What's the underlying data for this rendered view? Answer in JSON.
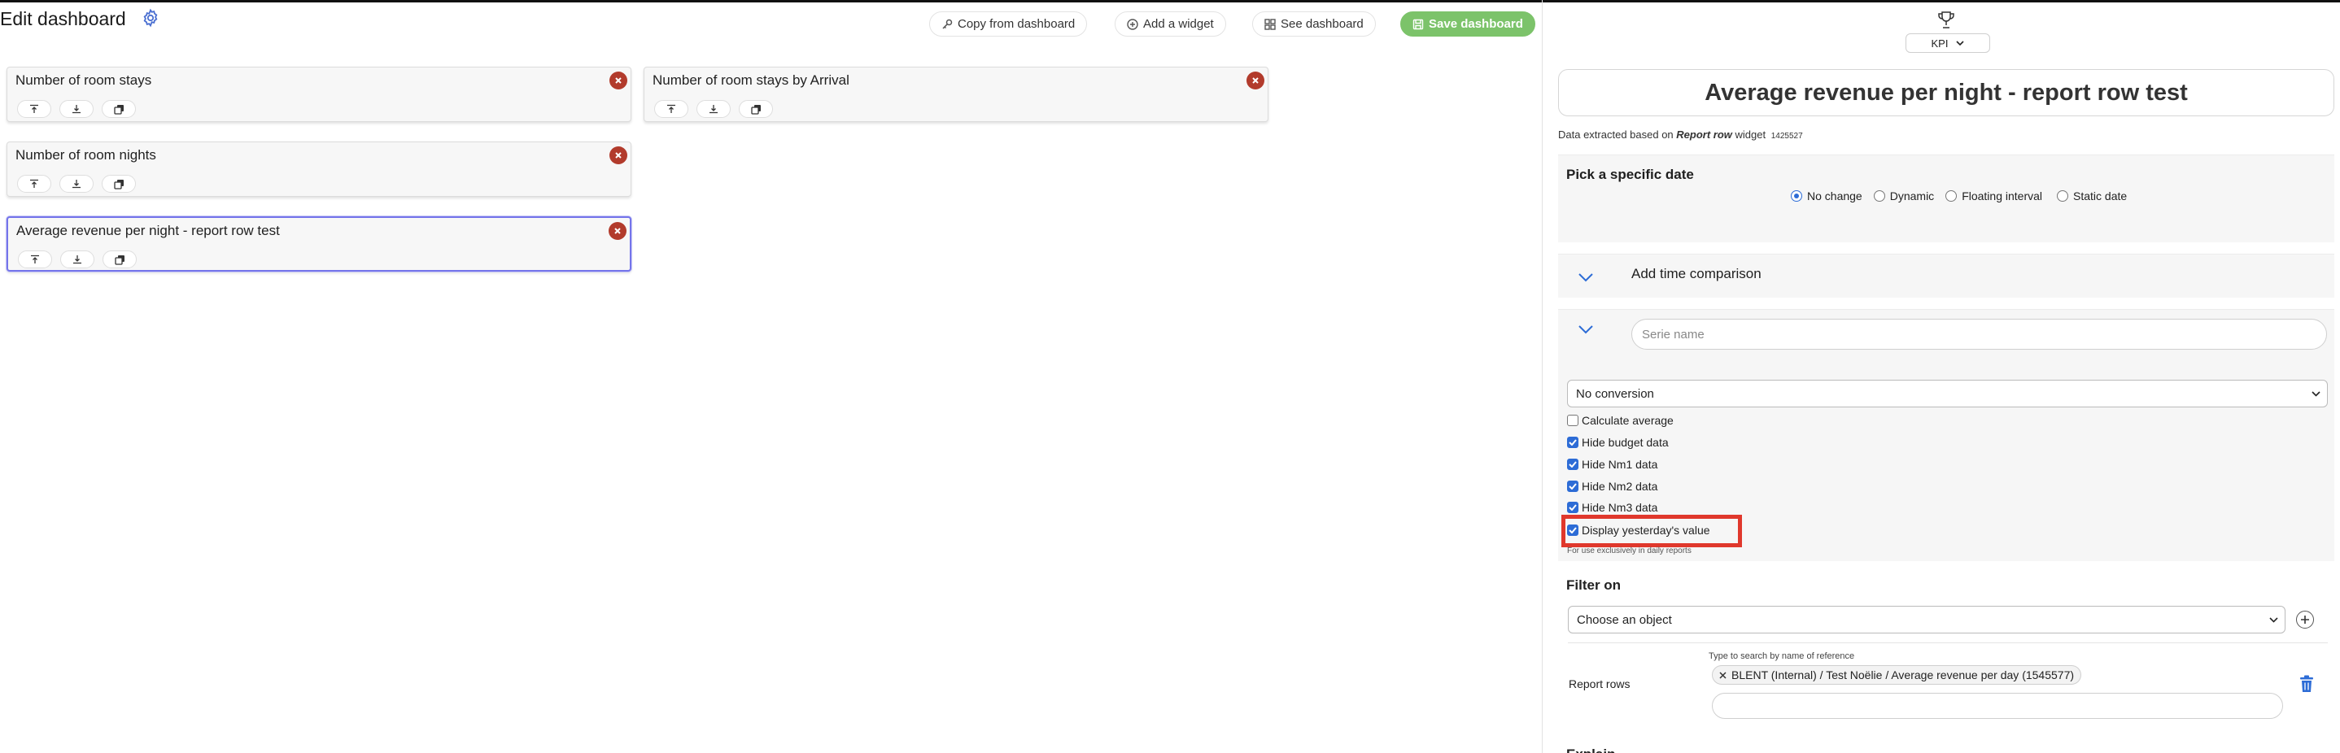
{
  "header": {
    "title": "Edit dashboard",
    "copy_label": "Copy from dashboard",
    "add_widget_label": "Add a widget",
    "see_label": "See dashboard",
    "save_label": "Save dashboard"
  },
  "widgets": [
    {
      "title": "Number of room stays"
    },
    {
      "title": "Number of room stays by Arrival"
    },
    {
      "title": "Number of room nights"
    },
    {
      "title": "Average revenue per night - report row test"
    }
  ],
  "panel": {
    "widget_type": "KPI",
    "title": "Average revenue per night - report row test",
    "extracted_prefix": "Data extracted based on",
    "extracted_widget": "Report row",
    "extracted_suffix": "widget",
    "extracted_id": "1425527",
    "date_section": {
      "heading": "Pick a specific date",
      "options": [
        "No change",
        "Dynamic",
        "Floating interval",
        "Static date"
      ],
      "selected": "No change"
    },
    "time_comparison_label": "Add time comparison",
    "serie_placeholder": "Serie name",
    "conversion_value": "No conversion",
    "checkboxes": [
      {
        "label": "Calculate average",
        "checked": false
      },
      {
        "label": "Hide budget data",
        "checked": true
      },
      {
        "label": "Hide Nm1 data",
        "checked": true
      },
      {
        "label": "Hide Nm2 data",
        "checked": true
      },
      {
        "label": "Hide Nm3 data",
        "checked": true
      },
      {
        "label": "Display yesterday's value",
        "checked": true
      }
    ],
    "daily_hint": "For use exclusively in daily reports",
    "filter_heading": "Filter on",
    "object_select_value": "Choose an object",
    "search_hint": "Type to search by name of reference",
    "report_rows_label": "Report rows",
    "report_row_tag": "BLENT (Internal) / Test Noëlie / Average revenue per day (1545577)",
    "next_heading": "Explain"
  },
  "colors": {
    "save": "#7cc36a",
    "remove": "#b23b2c",
    "active_border": "#7474ea",
    "highlight": "#e0382c",
    "accent": "#2d6cd6"
  }
}
